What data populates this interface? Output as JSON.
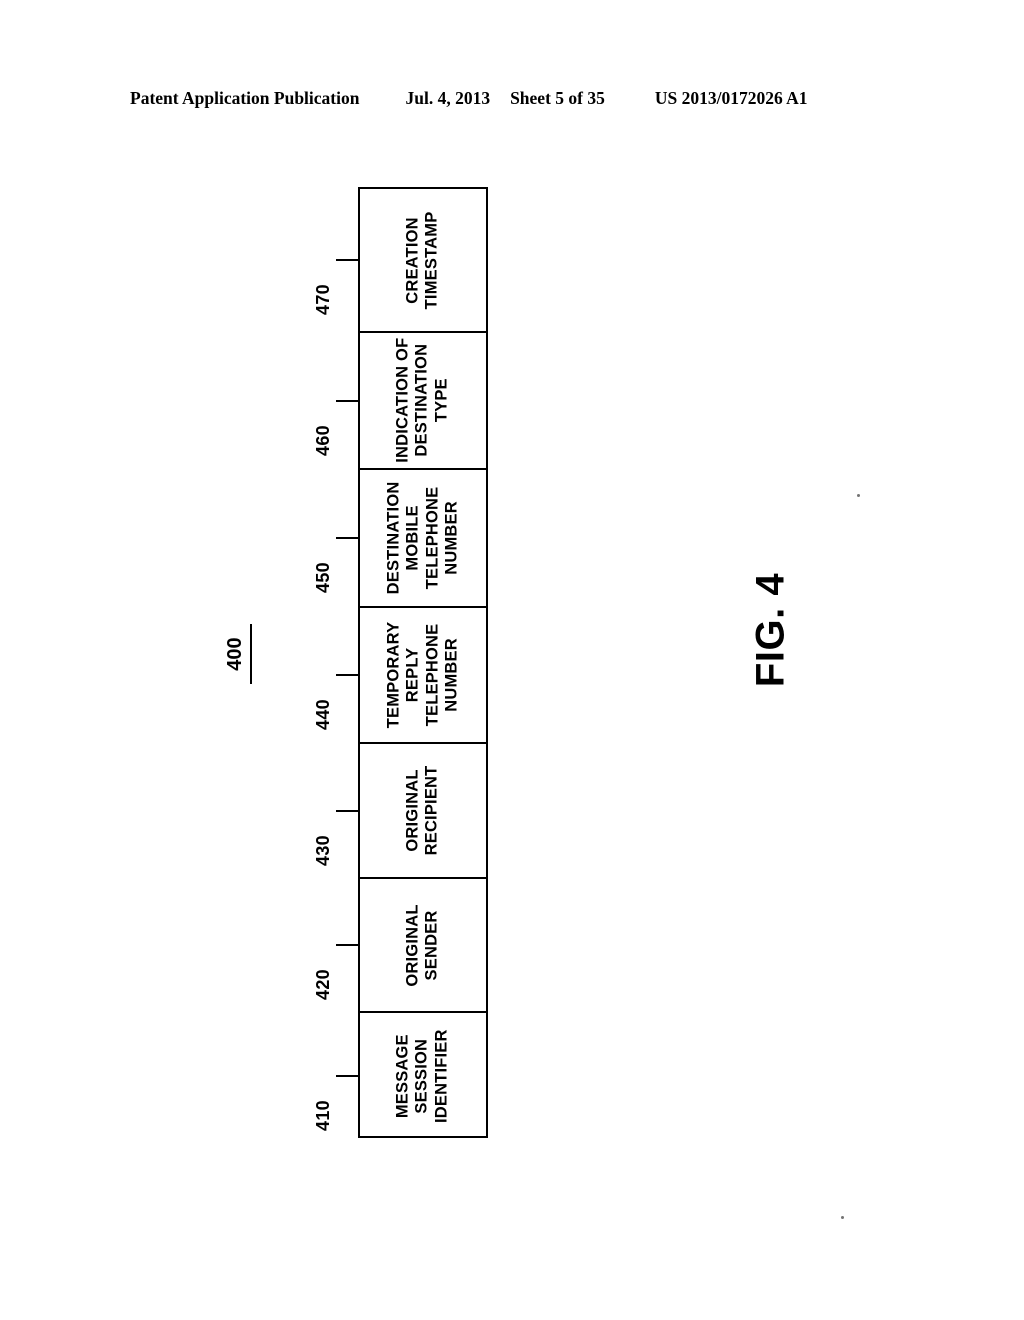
{
  "header": {
    "publication": "Patent Application Publication",
    "date": "Jul. 4, 2013",
    "sheet": "Sheet 5 of 35",
    "patent_number": "US 2013/0172026 A1"
  },
  "figure": {
    "caption": "FIG. 4",
    "figure_reference": "400",
    "blocks": [
      {
        "ref": "470",
        "lines": [
          "CREATION",
          "TIMESTAMP"
        ],
        "name": "creation-timestamp"
      },
      {
        "ref": "460",
        "lines": [
          "INDICATION OF",
          "DESTINATION",
          "TYPE"
        ],
        "name": "indication-of-destination-type"
      },
      {
        "ref": "450",
        "lines": [
          "DESTINATION",
          "MOBILE",
          "TELEPHONE",
          "NUMBER"
        ],
        "name": "destination-mobile-telephone-number"
      },
      {
        "ref": "440",
        "lines": [
          "TEMPORARY",
          "REPLY",
          "TELEPHONE",
          "NUMBER"
        ],
        "name": "temporary-reply-telephone-number"
      },
      {
        "ref": "430",
        "lines": [
          "ORIGINAL",
          "RECIPIENT"
        ],
        "name": "original-recipient"
      },
      {
        "ref": "420",
        "lines": [
          "ORIGINAL",
          "SENDER"
        ],
        "name": "original-sender"
      },
      {
        "ref": "410",
        "lines": [
          "MESSAGE",
          "SESSION",
          "IDENTIFIER"
        ],
        "name": "message-session-identifier"
      }
    ]
  },
  "colors": {
    "ink": "#000000",
    "paper": "#ffffff"
  }
}
